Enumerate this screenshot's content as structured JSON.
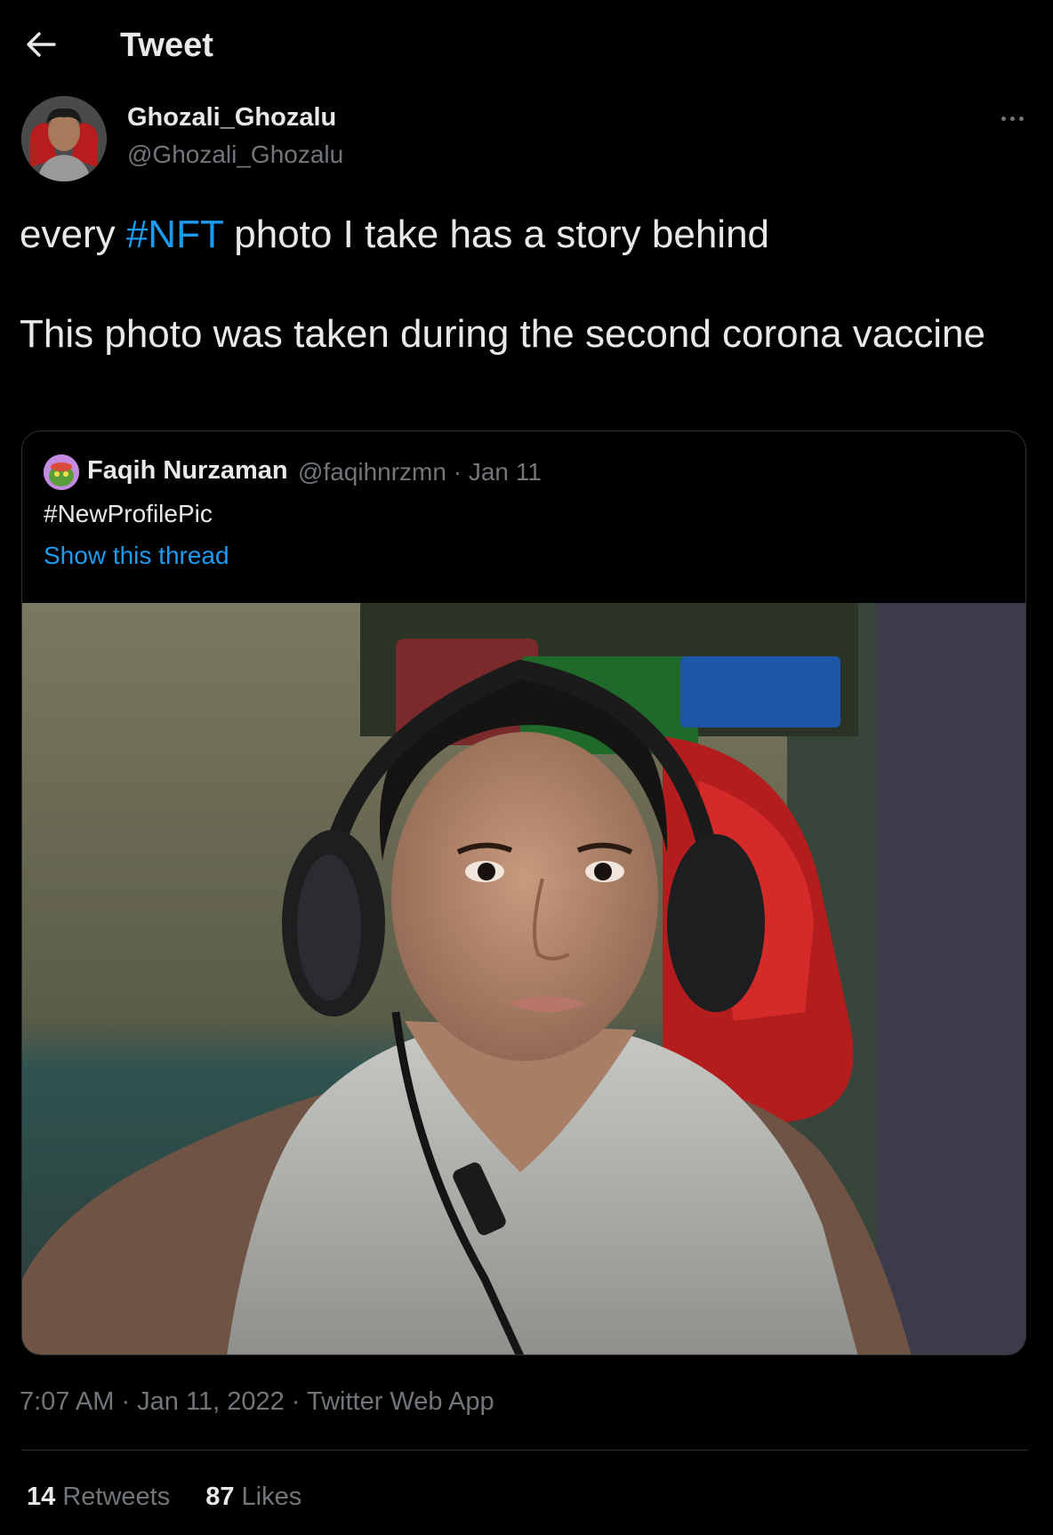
{
  "header": {
    "title": "Tweet",
    "back_icon": "arrow-left-icon"
  },
  "tweet": {
    "author_name": "Ghozali_Ghozalu",
    "author_handle": "@Ghozali_Ghozalu",
    "text_line1_before": "every ",
    "text_line1_hashtag": "#NFT",
    "text_line1_after": " photo I take has a story behind",
    "text_paragraph2": "This photo was taken during the second corona vaccine",
    "timestamp": "7:07 AM · Jan 11, 2022 · Twitter Web App",
    "retweets_count": "14",
    "retweets_label": "Retweets",
    "likes_count": "87",
    "likes_label": "Likes"
  },
  "quoted_tweet": {
    "author_name": "Faqih Nurzaman",
    "author_handle_date": "@faqihnrzmn · Jan 11",
    "text": "#NewProfilePic",
    "show_thread_link": "Show this thread"
  },
  "colors": {
    "background": "#000000",
    "text": "#e7e9ea",
    "secondary_text": "#71767b",
    "accent": "#1d9bf0",
    "border": "#2f3336"
  }
}
